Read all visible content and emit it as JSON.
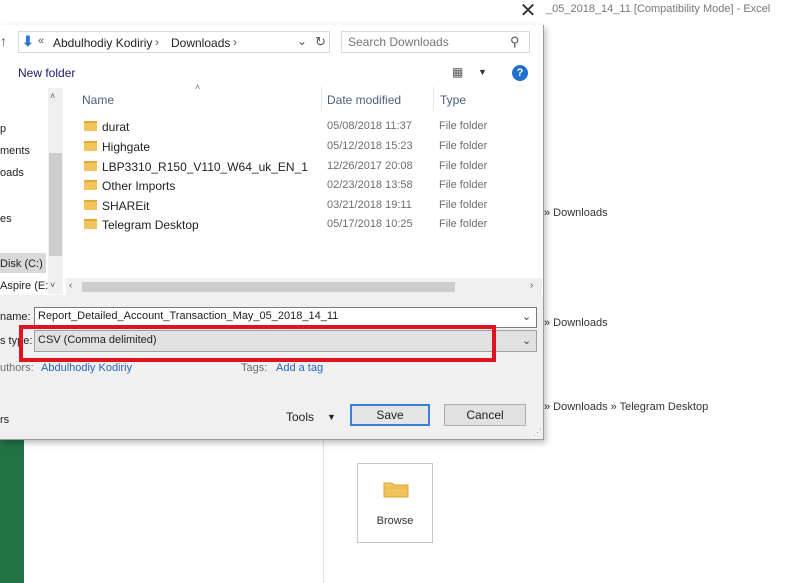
{
  "excel": {
    "title": "_05_2018_14_11  [Compatibility Mode] - Excel",
    "close_glyph": "✕",
    "recent_paths": [
      "» Downloads",
      "» Downloads",
      "» Downloads » Telegram Desktop"
    ],
    "browse_label": "Browse"
  },
  "dialog": {
    "address": {
      "up_glyph": "↑",
      "down_glyph": "⬇",
      "overflow_glyph": "«",
      "crumbs": [
        "Abdulhodiy Kodiriy",
        "Downloads"
      ],
      "separator": "›",
      "dropdown_glyph": "⌄",
      "refresh_glyph": "↻"
    },
    "search": {
      "placeholder": "Search Downloads",
      "icon": "search-icon",
      "glyph": "⚲"
    },
    "toolbar": {
      "new_folder": "New folder",
      "view_glyph": "▦",
      "view_dd_glyph": "▼",
      "help_glyph": "?"
    },
    "nav": {
      "items": [
        "p",
        "ments",
        "oads",
        "es",
        "Disk (C:)",
        "Aspire (E:)"
      ],
      "selected": "Disk (C:)",
      "up_glyph": "˄",
      "down_glyph": "˅"
    },
    "columns": {
      "name": "Name",
      "date": "Date modified",
      "type": "Type",
      "sort_glyph": "˄"
    },
    "files": [
      {
        "name": "durat",
        "date": "05/08/2018 11:37",
        "type": "File folder"
      },
      {
        "name": "Highgate",
        "date": "05/12/2018 15:23",
        "type": "File folder"
      },
      {
        "name": "LBP3310_R150_V110_W64_uk_EN_1",
        "date": "12/26/2017 20:08",
        "type": "File folder"
      },
      {
        "name": "Other Imports",
        "date": "02/23/2018 13:58",
        "type": "File folder"
      },
      {
        "name": "SHAREit",
        "date": "03/21/2018 19:11",
        "type": "File folder"
      },
      {
        "name": "Telegram Desktop",
        "date": "05/17/2018 10:25",
        "type": "File folder"
      }
    ],
    "hscroll": {
      "left_glyph": "‹",
      "right_glyph": "›"
    },
    "form": {
      "filename_label": "name:",
      "filename_value": "Report_Detailed_Account_Transaction_May_05_2018_14_11",
      "filetype_label": "s type:",
      "filetype_value": "CSV (Comma delimited)",
      "authors_label": "uthors:",
      "authors_value": "Abdulhodiy Kodiriy",
      "tags_label": "Tags:",
      "tags_value": "Add a tag",
      "hide_label": "rs",
      "tools_label": "Tools",
      "tools_dd_glyph": "▼",
      "save_label": "Save",
      "cancel_label": "Cancel",
      "dd_glyph": "⌄",
      "grip_glyph": "⋰"
    }
  },
  "colors": {
    "excel_green": "#217346",
    "highlight_red": "#e0141e",
    "link_blue": "#2566c6",
    "folder_yellow": "#f2c55c"
  }
}
